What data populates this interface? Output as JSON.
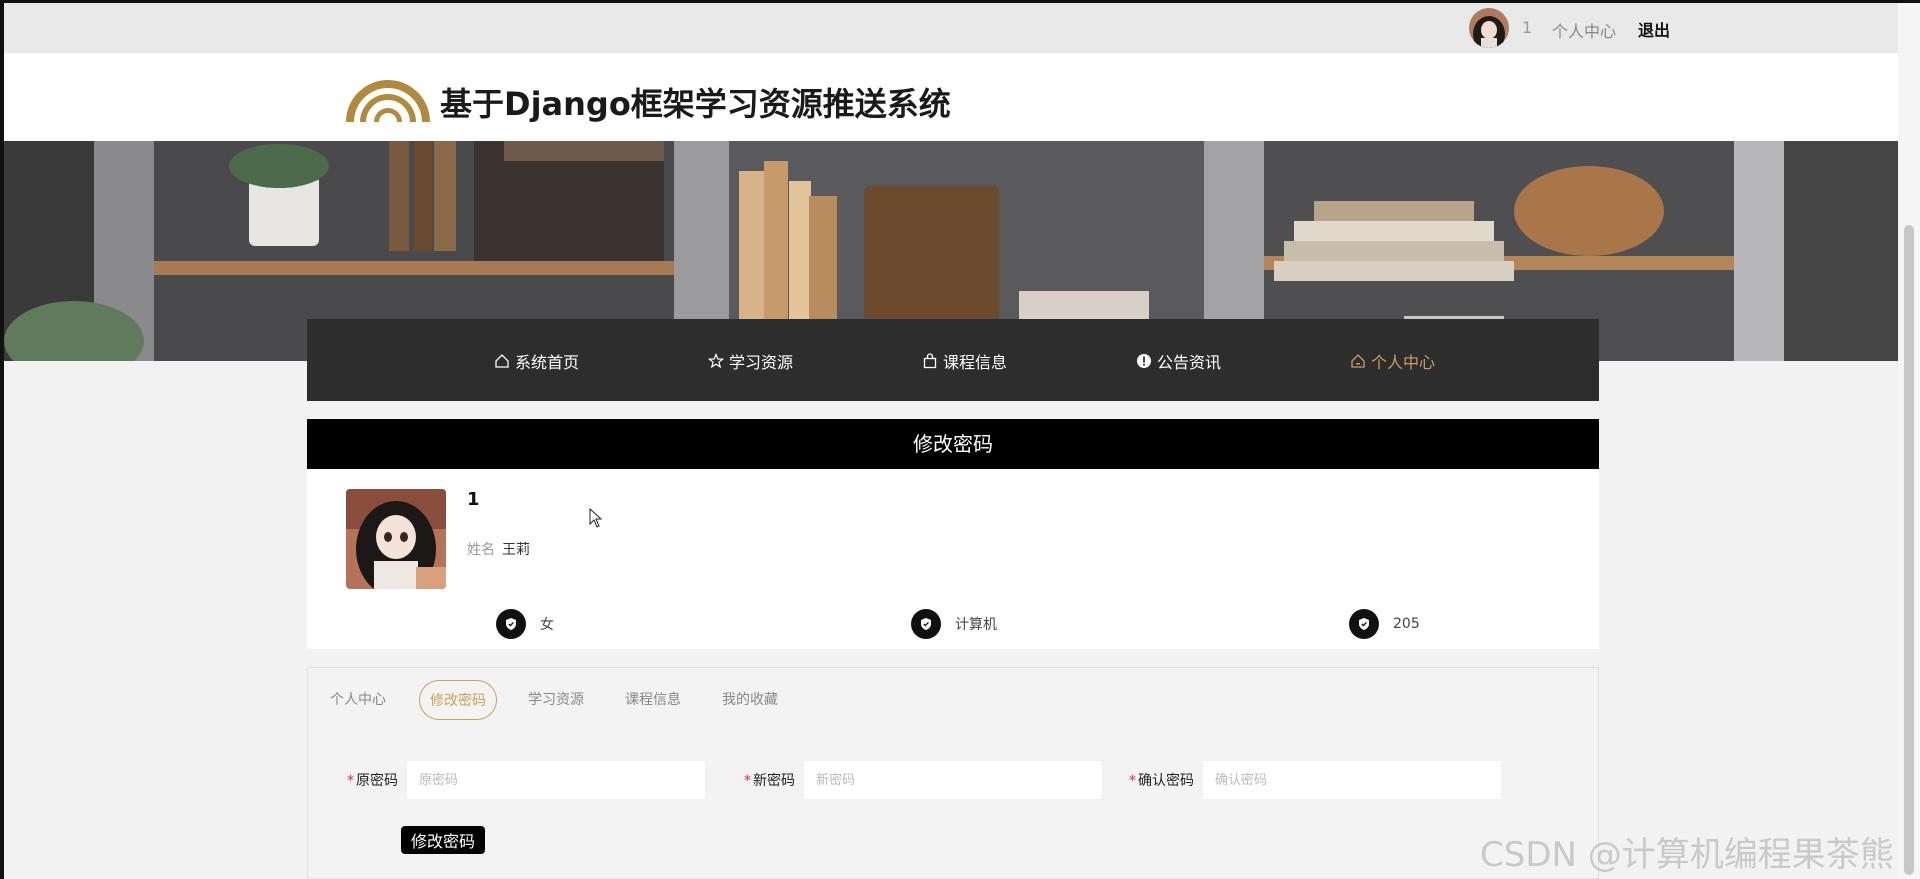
{
  "topbar": {
    "username": "1",
    "center_link": "个人中心",
    "logout": "退出"
  },
  "header": {
    "site_title": "基于Django框架学习资源推送系统"
  },
  "nav": {
    "items": [
      {
        "label": "系统首页",
        "icon": "home-icon"
      },
      {
        "label": "学习资源",
        "icon": "star-icon"
      },
      {
        "label": "课程信息",
        "icon": "bag-icon"
      },
      {
        "label": "公告资讯",
        "icon": "info-icon"
      },
      {
        "label": "个人中心",
        "icon": "home-icon"
      }
    ],
    "active_index": 4,
    "active_color": "#c9a062"
  },
  "page": {
    "title": "修改密码"
  },
  "profile": {
    "username": "1",
    "name_label": "姓名",
    "name_value": "王莉",
    "stats": [
      {
        "icon": "shield-icon",
        "value": "女"
      },
      {
        "icon": "shield-icon",
        "value": "计算机"
      },
      {
        "icon": "shield-icon",
        "value": "205"
      }
    ]
  },
  "tabs": [
    {
      "label": "个人中心",
      "active": false
    },
    {
      "label": "修改密码",
      "active": true
    },
    {
      "label": "学习资源",
      "active": false
    },
    {
      "label": "课程信息",
      "active": false
    },
    {
      "label": "我的收藏",
      "active": false
    }
  ],
  "form": {
    "old_password": {
      "label": "原密码",
      "placeholder": "原密码",
      "value": ""
    },
    "new_password": {
      "label": "新密码",
      "placeholder": "新密码",
      "value": ""
    },
    "confirm_password": {
      "label": "确认密码",
      "placeholder": "确认密码",
      "value": ""
    },
    "required_mark": "*",
    "submit_label": "修改密码"
  },
  "watermark": "CSDN @计算机编程果茶熊"
}
